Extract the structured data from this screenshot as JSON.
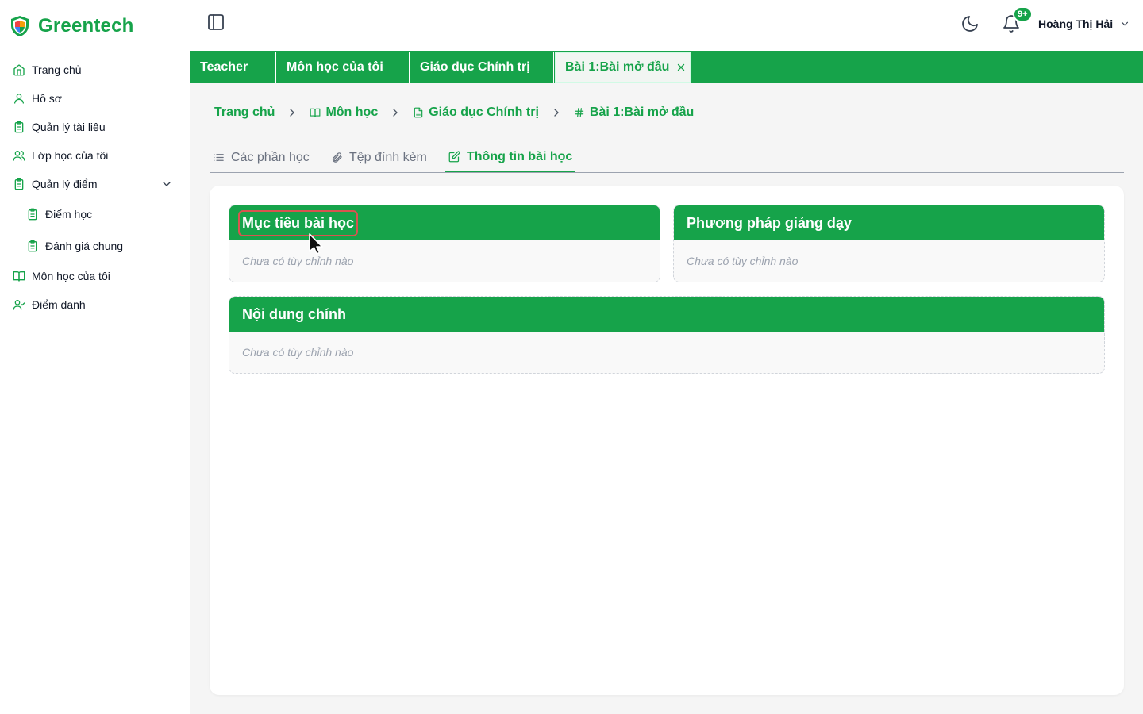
{
  "app": {
    "brand": "Greentech"
  },
  "sidebar": {
    "items": [
      {
        "label": "Trang chủ",
        "icon": "home-icon"
      },
      {
        "label": "Hồ sơ",
        "icon": "user-icon"
      },
      {
        "label": "Quản lý tài liệu",
        "icon": "clipboard-icon"
      },
      {
        "label": "Lớp học của tôi",
        "icon": "users-icon"
      },
      {
        "label": "Quản lý điểm",
        "icon": "clipboard-icon",
        "expanded": true
      },
      {
        "label": "Môn học của tôi",
        "icon": "book-icon"
      },
      {
        "label": "Điểm danh",
        "icon": "user-check-icon"
      }
    ],
    "subitems": [
      {
        "label": "Điểm học",
        "icon": "clipboard-icon"
      },
      {
        "label": "Đánh giá chung",
        "icon": "clipboard-icon"
      }
    ]
  },
  "header": {
    "notification_badge": "9+",
    "user_name": "Hoàng Thị Hải"
  },
  "tabs": [
    {
      "label": "Teacher"
    },
    {
      "label": "Môn học của tôi"
    },
    {
      "label": "Giáo dục Chính trị"
    },
    {
      "label": "Bài 1:Bài mở đầu",
      "active": true
    }
  ],
  "breadcrumb": [
    {
      "label": "Trang chủ"
    },
    {
      "label": "Môn học",
      "icon": "book-icon"
    },
    {
      "label": "Giáo dục Chính trị",
      "icon": "file-icon"
    },
    {
      "label": "Bài 1:Bài mở đầu",
      "icon": "hash-icon"
    }
  ],
  "section_tabs": [
    {
      "label": "Các phần học",
      "icon": "list-icon"
    },
    {
      "label": "Tệp đính kèm",
      "icon": "paperclip-icon"
    },
    {
      "label": "Thông tin bài học",
      "icon": "edit-icon",
      "active": true
    }
  ],
  "panels": [
    {
      "title": "Mục tiêu bài học",
      "body": "Chưa có tùy chỉnh nào"
    },
    {
      "title": "Phương pháp giảng dạy",
      "body": "Chưa có tùy chỉnh nào"
    },
    {
      "title": "Nội dung chính",
      "body": "Chưa có tùy chỉnh nào"
    }
  ],
  "colors": {
    "accent": "#16a34a",
    "highlight": "#d9534f"
  }
}
